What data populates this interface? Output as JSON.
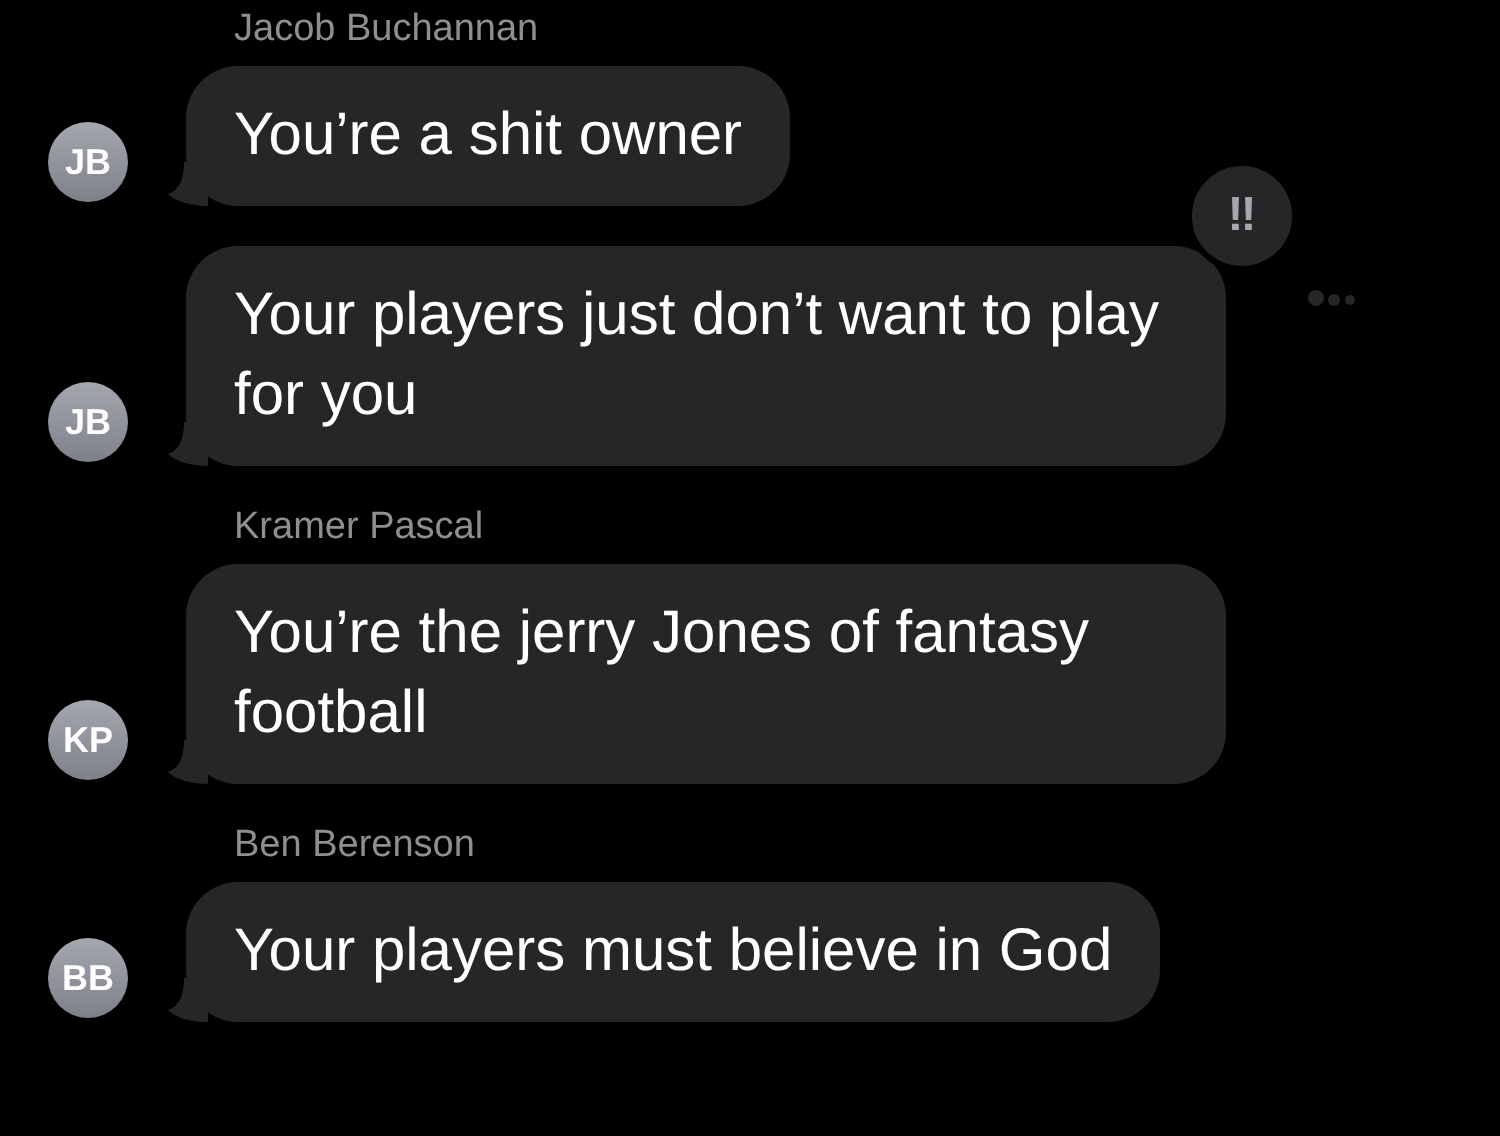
{
  "groups": [
    {
      "sender": "Jacob Buchannan",
      "messages": [
        {
          "avatar": "JB",
          "text": "You’re a shit owner"
        },
        {
          "avatar": "JB",
          "text": "Your players just don’t want to play for you",
          "reaction": "‼"
        }
      ]
    },
    {
      "sender": "Kramer Pascal",
      "messages": [
        {
          "avatar": "KP",
          "text": "You’re the jerry Jones of fantasy football"
        }
      ]
    },
    {
      "sender": "Ben Berenson",
      "messages": [
        {
          "avatar": "BB",
          "text": "Your players must believe in God"
        }
      ]
    }
  ]
}
